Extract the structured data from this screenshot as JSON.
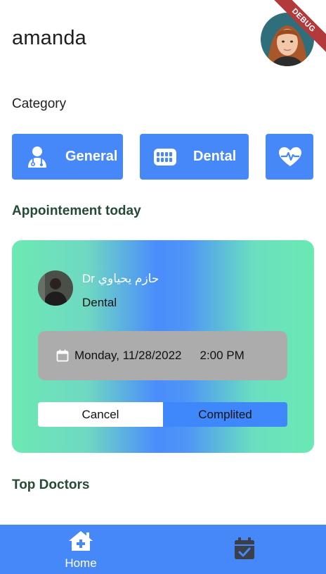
{
  "header": {
    "username": "amanda",
    "debug_label": "DEBUG"
  },
  "sections": {
    "category": "Category",
    "appointment_today": "Appointement today",
    "top_doctors": "Top Doctors"
  },
  "categories": [
    {
      "label": "General",
      "icon": "doctor-icon"
    },
    {
      "label": "Dental",
      "icon": "teeth-icon"
    },
    {
      "label": "",
      "icon": "heart-pulse-icon"
    }
  ],
  "appointment": {
    "doctor_name": "Dr حازم يحياوي",
    "specialty": "Dental",
    "date": "Monday, 11/28/2022",
    "time": "2:00 PM",
    "cancel_label": "Cancel",
    "complete_label": "Complited"
  },
  "bottom_nav": {
    "home_label": "Home",
    "home_icon": "home-plus-icon",
    "appointments_icon": "calendar-check-icon"
  },
  "colors": {
    "primary": "#4688f8",
    "heading_green": "#254a36",
    "gradient_green": "#6ce9b3",
    "gradient_blue": "#4a8cfc",
    "date_box": "#acacac",
    "nav_inactive_icon": "#3b3f4a"
  }
}
